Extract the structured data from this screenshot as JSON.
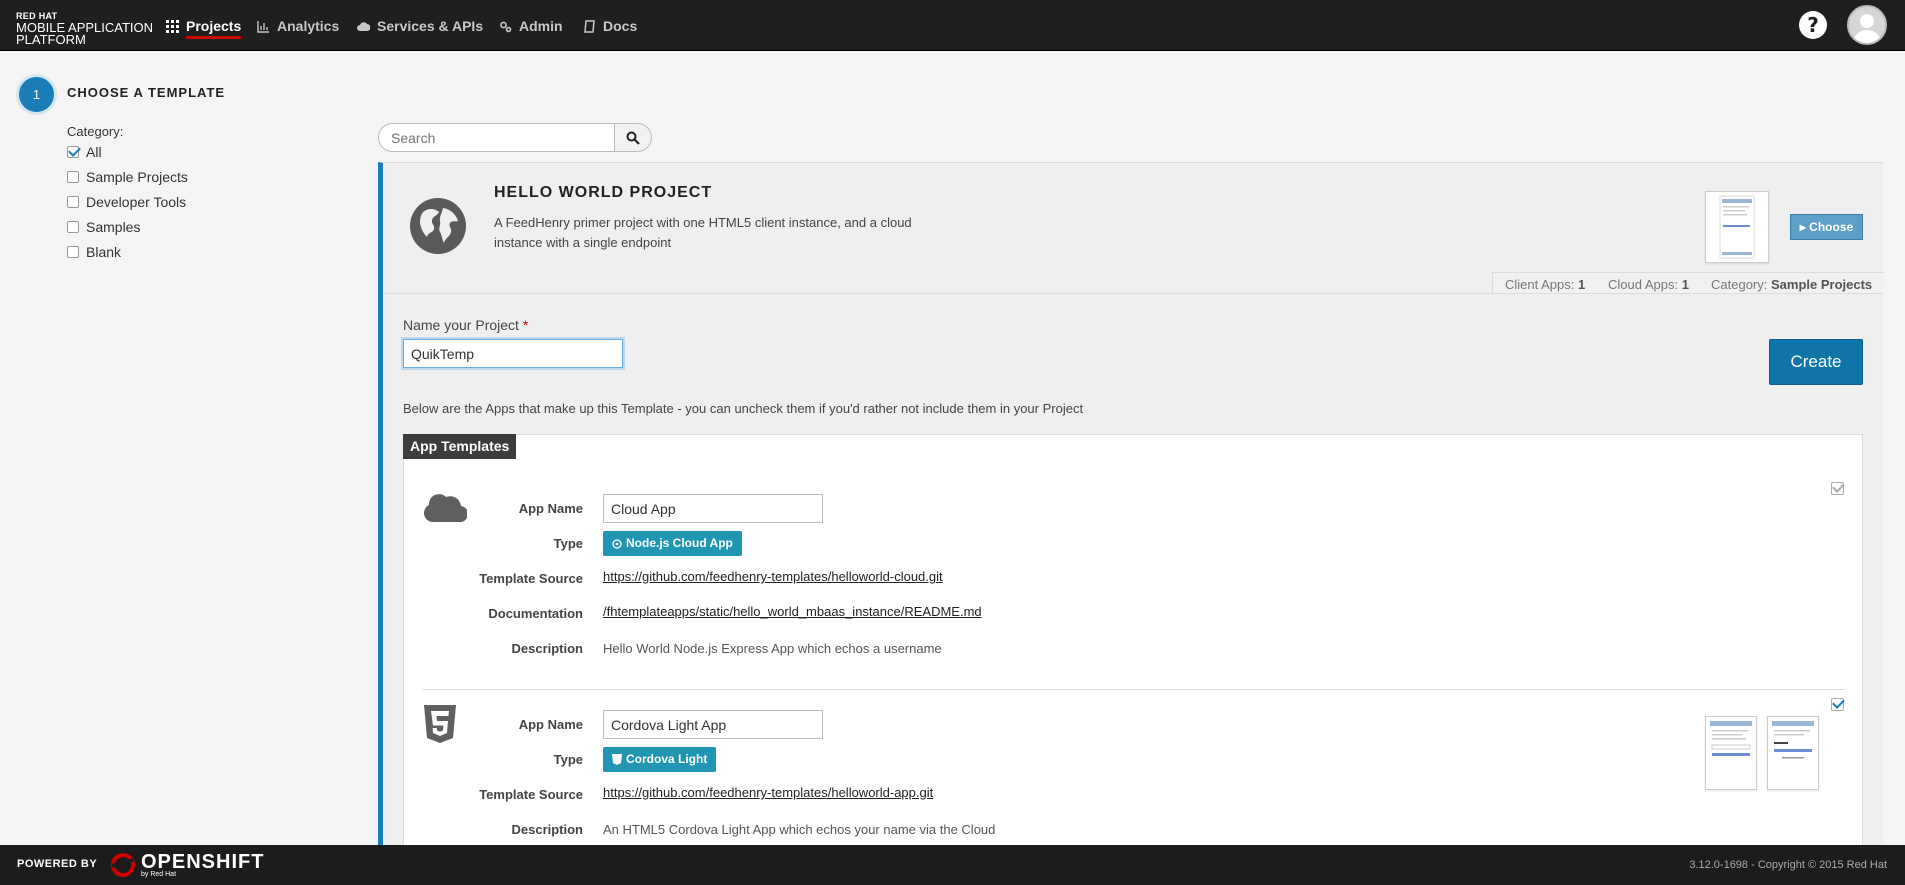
{
  "brand": {
    "redhat": "RED HAT",
    "line1": "MOBILE APPLICATION",
    "line2": "PLATFORM"
  },
  "nav": [
    {
      "label": "Projects",
      "icon": "grid-icon",
      "active": true
    },
    {
      "label": "Analytics",
      "icon": "bar-chart-icon"
    },
    {
      "label": "Services & APIs",
      "icon": "cloud-icon"
    },
    {
      "label": "Admin",
      "icon": "gears-icon"
    },
    {
      "label": "Docs",
      "icon": "book-icon"
    }
  ],
  "help_label": "?",
  "step": {
    "number": "1",
    "title": "CHOOSE A TEMPLATE"
  },
  "category": {
    "label": "Category:",
    "items": [
      {
        "label": "All",
        "checked": true
      },
      {
        "label": "Sample Projects",
        "checked": false
      },
      {
        "label": "Developer Tools",
        "checked": false
      },
      {
        "label": "Samples",
        "checked": false
      },
      {
        "label": "Blank",
        "checked": false
      }
    ]
  },
  "search": {
    "placeholder": "Search"
  },
  "template": {
    "title": "HELLO WORLD PROJECT",
    "description": "A FeedHenry primer project with one HTML5 client instance, and a cloud instance with a single endpoint",
    "choose_label": "Choose",
    "meta": {
      "client_label": "Client Apps:",
      "client_value": "1",
      "cloud_label": "Cloud Apps:",
      "cloud_value": "1",
      "category_label": "Category:",
      "category_value": "Sample Projects"
    }
  },
  "project": {
    "label": "Name your Project",
    "required": "*",
    "value": "QuikTemp",
    "create_label": "Create"
  },
  "below_text": "Below are the Apps that make up this Template - you can uncheck them if you'd rather not include them in your Project",
  "app_templates": {
    "tag": "App Templates",
    "labels": {
      "name": "App Name",
      "type": "Type",
      "source": "Template Source",
      "docs": "Documentation",
      "desc": "Description"
    },
    "apps": [
      {
        "icon": "cloud-icon",
        "name": "Cloud App",
        "type": "Node.js Cloud App",
        "source": "https://github.com/feedhenry-templates/helloworld-cloud.git",
        "documentation": "/fhtemplateapps/static/hello_world_mbaas_instance/README.md",
        "description": "Hello World Node.js Express App which echos a username",
        "checked": true
      },
      {
        "icon": "html5-icon",
        "name": "Cordova Light App",
        "type": "Cordova Light",
        "source": "https://github.com/feedhenry-templates/helloworld-app.git",
        "description": "An HTML5 Cordova Light App which echos your name via the Cloud",
        "checked": true
      }
    ]
  },
  "footer": {
    "powered": "POWERED BY",
    "openshift": "OPENSHIFT",
    "by": "by Red Hat",
    "copyright": "3.12.0-1698 - Copyright © 2015 Red Hat"
  },
  "colors": {
    "accent": "#1b7db8",
    "create": "#0f75a8",
    "badge": "#2196b3",
    "nav_bg": "#1f1f1f",
    "active_underline": "#cc0000"
  }
}
